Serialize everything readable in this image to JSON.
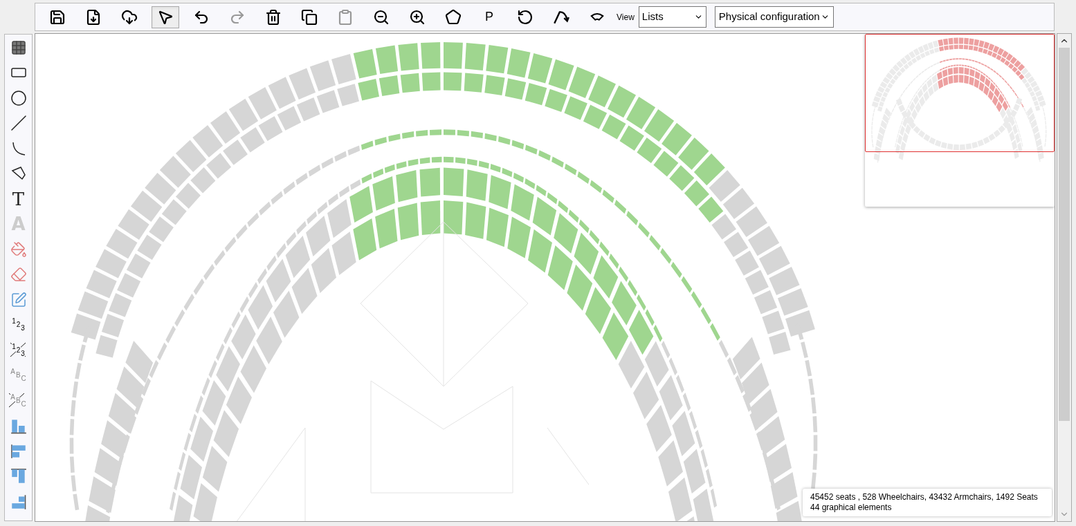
{
  "toolbar": {
    "buttons": [
      {
        "selected": false,
        "disabled": false
      },
      {
        "selected": false,
        "disabled": false
      },
      {
        "selected": false,
        "disabled": false
      },
      {
        "selected": true,
        "disabled": false
      },
      {
        "selected": false,
        "disabled": false
      },
      {
        "selected": false,
        "disabled": true
      },
      {
        "selected": false,
        "disabled": false
      },
      {
        "selected": false,
        "disabled": false
      },
      {
        "selected": false,
        "disabled": true
      },
      {
        "selected": false,
        "disabled": false
      },
      {
        "selected": false,
        "disabled": false
      },
      {
        "selected": false,
        "disabled": false
      },
      {
        "selected": false,
        "disabled": false,
        "label": "P"
      },
      {
        "selected": false,
        "disabled": false
      },
      {
        "selected": false,
        "disabled": false
      },
      {
        "selected": false,
        "disabled": false
      }
    ],
    "view_label": "View",
    "view_select": "Lists",
    "config_select": "Physical configuration"
  },
  "tools": [
    {
      "kind": "icon"
    },
    {
      "kind": "icon"
    },
    {
      "kind": "icon"
    },
    {
      "kind": "icon"
    },
    {
      "kind": "icon"
    },
    {
      "kind": "icon"
    },
    {
      "kind": "glyph",
      "glyph": "T"
    },
    {
      "kind": "glyph",
      "glyph": "A"
    },
    {
      "kind": "icon"
    },
    {
      "kind": "icon"
    },
    {
      "kind": "icon"
    },
    {
      "kind": "steps",
      "glyph": "123"
    },
    {
      "kind": "steps_crossed",
      "glyph": "123"
    },
    {
      "kind": "steps",
      "glyph": "ABC"
    },
    {
      "kind": "steps_crossed",
      "glyph": "ABC"
    },
    {
      "kind": "icon"
    },
    {
      "kind": "icon"
    },
    {
      "kind": "icon"
    },
    {
      "kind": "icon"
    }
  ],
  "status": {
    "line_1": "45452 seats , 528 Wheelchairs, 43432 Armchairs, 1492 Seats",
    "line_2": "44 graphical elements"
  }
}
